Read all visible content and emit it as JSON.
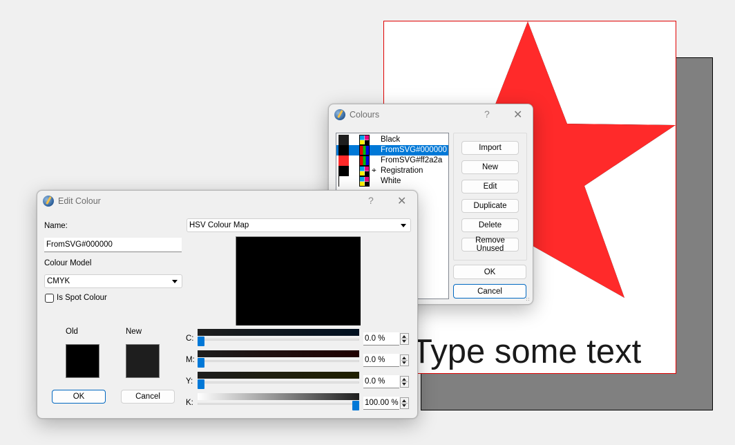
{
  "canvas": {
    "page_text": "Type some text",
    "star": {
      "fill": "#ff2a2a",
      "stroke": "#000000"
    },
    "page_border_color": "#e00000",
    "page_shadow_color": "#808080"
  },
  "colours_dialog": {
    "title": "Colours",
    "help_label": "?",
    "close_label": "✕",
    "colours": [
      {
        "name": "Black",
        "swatch": "#1e1e1e",
        "model": "CMYK",
        "selected": false,
        "registration": false
      },
      {
        "name": "FromSVG#000000",
        "swatch": "#000000",
        "model": "RGB",
        "selected": true,
        "registration": false
      },
      {
        "name": "FromSVG#ff2a2a",
        "swatch": "#ff2a2a",
        "model": "RGB",
        "selected": false,
        "registration": false
      },
      {
        "name": "Registration",
        "swatch": "#000000",
        "model": "CMYK",
        "selected": false,
        "registration": true
      },
      {
        "name": "White",
        "swatch": "#ffffff",
        "model": "CMYK",
        "selected": false,
        "registration": false
      }
    ],
    "registration_icon": "⌖",
    "buttons": {
      "import": "Import",
      "new": "New",
      "edit": "Edit",
      "duplicate": "Duplicate",
      "delete": "Delete",
      "remove_unused": "Remove Unused",
      "ok": "OK",
      "cancel": "Cancel"
    }
  },
  "edit_dialog": {
    "title": "Edit Colour",
    "help_label": "?",
    "close_label": "✕",
    "name_label": "Name:",
    "name_value": "FromSVG#000000",
    "colour_model_label": "Colour Model",
    "colour_model_value": "CMYK",
    "spot_colour_label": "Is Spot Colour",
    "spot_colour_checked": false,
    "old_label": "Old",
    "new_label": "New",
    "old_color": "#000000",
    "new_color": "#1e1e1e",
    "map_type": "HSV Colour Map",
    "ok_label": "OK",
    "cancel_label": "Cancel",
    "channels": [
      {
        "label": "C:",
        "value_text": "0.0 %",
        "value": 0.0
      },
      {
        "label": "M:",
        "value_text": "0.0 %",
        "value": 0.0
      },
      {
        "label": "Y:",
        "value_text": "0.0 %",
        "value": 0.0
      },
      {
        "label": "K:",
        "value_text": "100.00 %",
        "value": 100.0
      }
    ],
    "accent_color": "#0078d7"
  }
}
